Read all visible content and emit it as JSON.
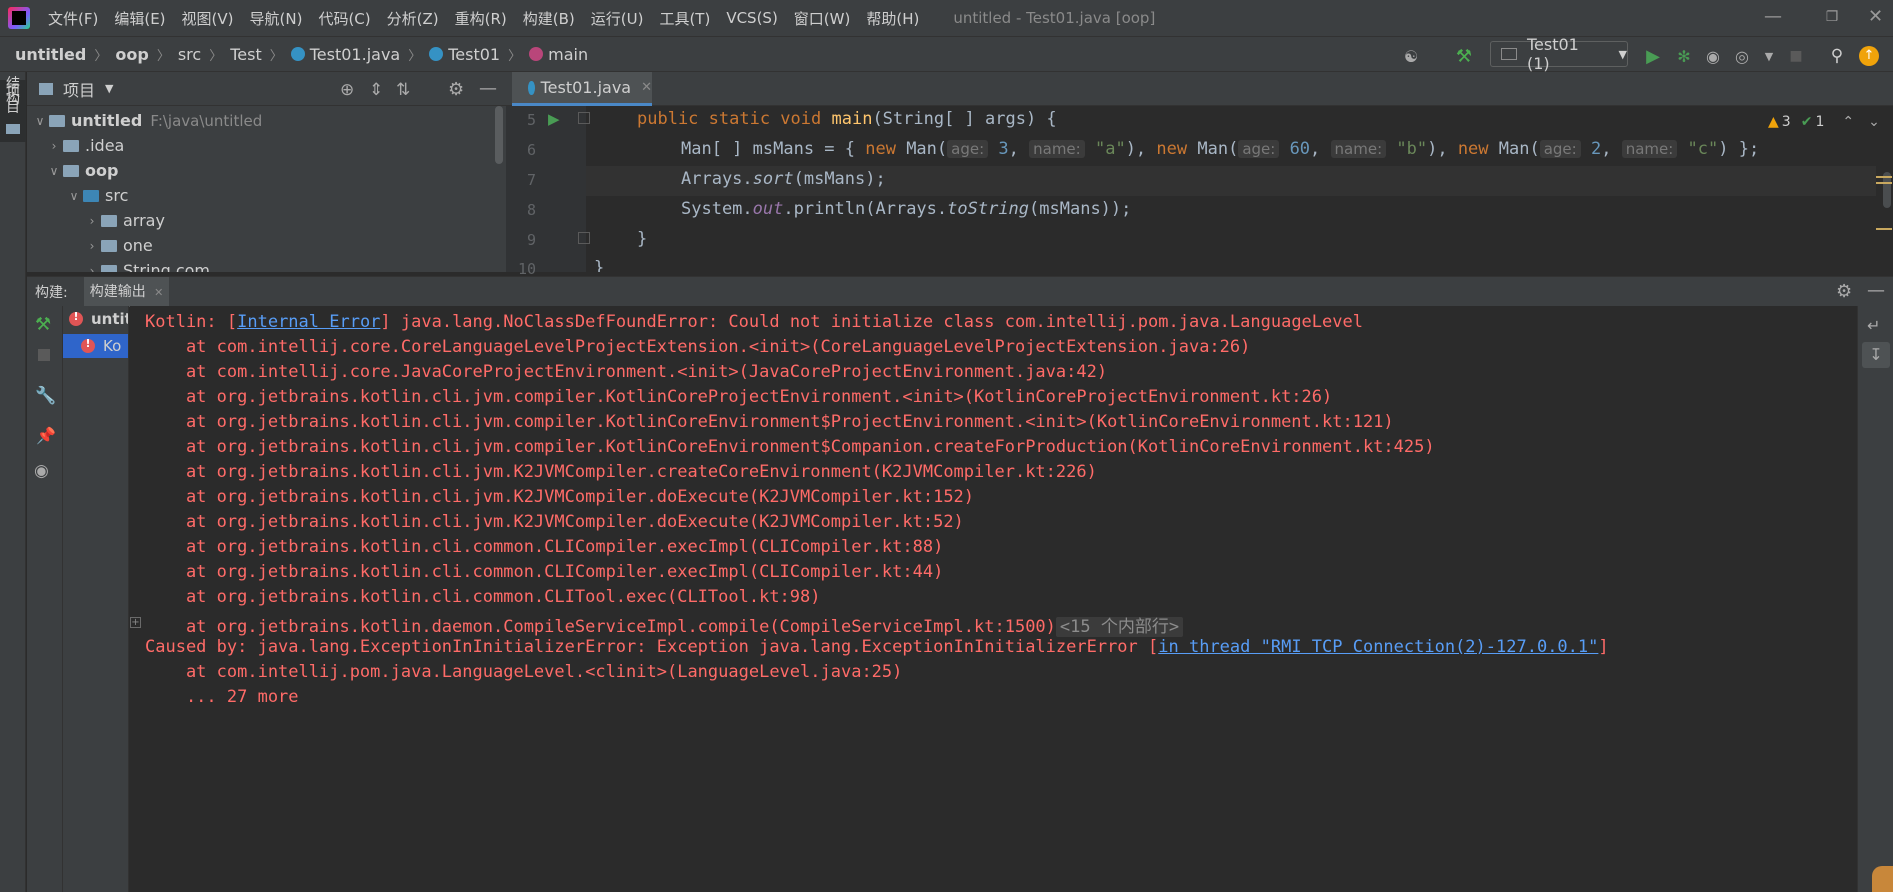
{
  "menubar": {
    "items": [
      "文件(F)",
      "编辑(E)",
      "视图(V)",
      "导航(N)",
      "代码(C)",
      "分析(Z)",
      "重构(R)",
      "构建(B)",
      "运行(U)",
      "工具(T)",
      "VCS(S)",
      "窗口(W)",
      "帮助(H)"
    ],
    "window_title": "untitled - Test01.java [oop]"
  },
  "breadcrumb": {
    "items": [
      "untitled",
      "oop",
      "src",
      "Test",
      "Test01.java",
      "Test01",
      "main"
    ]
  },
  "toolbar": {
    "run_config": "Test01 (1)"
  },
  "left_strip": {
    "project_tab": "项目",
    "structure_tab": "结构"
  },
  "project_panel": {
    "title": "项目",
    "tree": [
      {
        "label": "untitled",
        "path": "F:\\java\\untitled"
      },
      {
        "label": ".idea"
      },
      {
        "label": "oop"
      },
      {
        "label": "src"
      },
      {
        "label": "array"
      },
      {
        "label": "one"
      },
      {
        "label": "String.com"
      }
    ]
  },
  "editor": {
    "tab_label": "Test01.java",
    "line_numbers": [
      "5",
      "6",
      "7",
      "8",
      "9",
      "10"
    ],
    "inspections": {
      "warnings": "3",
      "ok": "1"
    },
    "code": {
      "l5_kw": "public static void",
      "l5_fn": "main",
      "l5_rest": "(String[ ] args) {",
      "l6_a": "Man[ ] msMans = { ",
      "kw_new": "new",
      "l6_man": " Man(",
      "hint_age": "age:",
      "hint_name": "name:",
      "l6_v1": "3",
      "l6_s1": "\"a\"",
      "l6_v2": "60",
      "l6_s2": "\"b\"",
      "l6_v3": "2",
      "l6_s3": "\"c\"",
      "l6_end": "};",
      "l7_a": "Arrays.",
      "l7_sort": "sort",
      "l7_b": "(msMans);",
      "l8_a": "System.",
      "l8_out": "out",
      "l8_b": ".println(Arrays.",
      "l8_tostring": "toString",
      "l8_c": "(msMans));",
      "l9": "}",
      "l10": "}"
    }
  },
  "build": {
    "label": "构建:",
    "tab": "构建输出",
    "tree_root": "untitled",
    "tree_child": "Ko"
  },
  "console": {
    "line1_a": "Kotlin: [",
    "line1_link": "Internal Error",
    "line1_b": "] java.lang.NoClassDefFoundError: Could not initialize class com.intellij.pom.java.LanguageLevel",
    "stack": [
      "    at com.intellij.core.CoreLanguageLevelProjectExtension.<init>(CoreLanguageLevelProjectExtension.java:26)",
      "    at com.intellij.core.JavaCoreProjectEnvironment.<init>(JavaCoreProjectEnvironment.java:42)",
      "    at org.jetbrains.kotlin.cli.jvm.compiler.KotlinCoreProjectEnvironment.<init>(KotlinCoreProjectEnvironment.kt:26)",
      "    at org.jetbrains.kotlin.cli.jvm.compiler.KotlinCoreEnvironment$ProjectEnvironment.<init>(KotlinCoreEnvironment.kt:121)",
      "    at org.jetbrains.kotlin.cli.jvm.compiler.KotlinCoreEnvironment$Companion.createForProduction(KotlinCoreEnvironment.kt:425)",
      "    at org.jetbrains.kotlin.cli.jvm.K2JVMCompiler.createCoreEnvironment(K2JVMCompiler.kt:226)",
      "    at org.jetbrains.kotlin.cli.jvm.K2JVMCompiler.doExecute(K2JVMCompiler.kt:152)",
      "    at org.jetbrains.kotlin.cli.jvm.K2JVMCompiler.doExecute(K2JVMCompiler.kt:52)",
      "    at org.jetbrains.kotlin.cli.common.CLICompiler.execImpl(CLICompiler.kt:88)",
      "    at org.jetbrains.kotlin.cli.common.CLICompiler.execImpl(CLICompiler.kt:44)",
      "    at org.jetbrains.kotlin.cli.common.CLITool.exec(CLITool.kt:98)",
      "    at org.jetbrains.kotlin.daemon.CompileServiceImpl.compile(CompileServiceImpl.kt:1500)"
    ],
    "folded": "<15 个内部行>",
    "caused_a": "Caused by: java.lang.ExceptionInInitializerError: Exception java.lang.ExceptionInInitializerError [",
    "caused_link": "in thread \"RMI TCP Connection(2)-127.0.0.1\"",
    "caused_b": "]",
    "tail": [
      "    at com.intellij.pom.java.LanguageLevel.<clinit>(LanguageLevel.java:25)",
      "    ... 27 more"
    ]
  },
  "colors": {
    "background": "#2b2b2b",
    "panel": "#3c3f41",
    "error_text": "#ff6b68",
    "link": "#589df6",
    "accent": "#4a88c7"
  }
}
